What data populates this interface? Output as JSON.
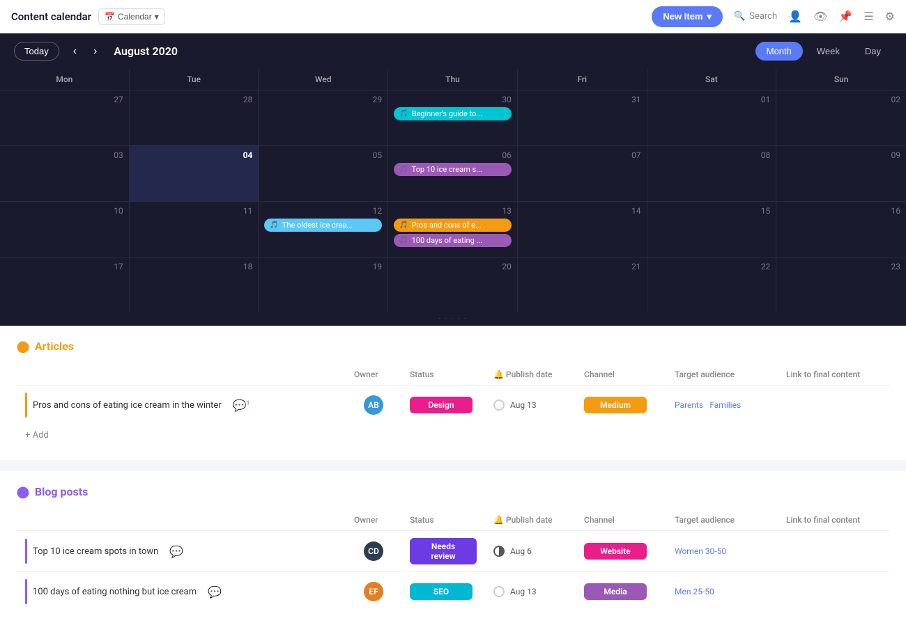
{
  "nav": {
    "title": "Content calendar",
    "calendar_btn": "Calendar",
    "new_item": "New Item",
    "search": "Search"
  },
  "calendar": {
    "month_label": "August 2020",
    "view_tabs": [
      "Month",
      "Week",
      "Day"
    ],
    "active_tab": "Month",
    "today_btn": "Today",
    "day_names": [
      "Mon",
      "Tue",
      "Wed",
      "Thu",
      "Fri",
      "Sat",
      "Sun"
    ],
    "weeks": [
      [
        {
          "date": "27",
          "events": []
        },
        {
          "date": "28",
          "events": []
        },
        {
          "date": "29",
          "events": []
        },
        {
          "date": "30",
          "events": [
            {
              "text": "Beginner's guide to...",
              "color": "cyan",
              "icon": "🎵"
            }
          ]
        },
        {
          "date": "31",
          "events": []
        },
        {
          "date": "01",
          "events": []
        },
        {
          "date": "02",
          "events": []
        }
      ],
      [
        {
          "date": "03",
          "events": []
        },
        {
          "date": "04",
          "events": [],
          "today": true
        },
        {
          "date": "05",
          "events": []
        },
        {
          "date": "06",
          "events": [
            {
              "text": "Top 10 ice cream s...",
              "color": "purple",
              "icon": "🎵"
            }
          ]
        },
        {
          "date": "07",
          "events": []
        },
        {
          "date": "08",
          "events": []
        },
        {
          "date": "09",
          "events": []
        }
      ],
      [
        {
          "date": "10",
          "events": []
        },
        {
          "date": "11",
          "events": []
        },
        {
          "date": "12",
          "events": [
            {
              "text": "The oldest ice crea...",
              "color": "blue-light",
              "icon": "🎵"
            }
          ]
        },
        {
          "date": "13",
          "events": [
            {
              "text": "Pros and cons of e...",
              "color": "orange",
              "icon": "🎵"
            },
            {
              "text": "100 days of eating ...",
              "color": "purple",
              "icon": "🎵"
            }
          ]
        },
        {
          "date": "14",
          "events": []
        },
        {
          "date": "15",
          "events": []
        },
        {
          "date": "16",
          "events": []
        }
      ],
      [
        {
          "date": "17",
          "events": []
        },
        {
          "date": "18",
          "events": []
        },
        {
          "date": "19",
          "events": []
        },
        {
          "date": "20",
          "events": []
        },
        {
          "date": "21",
          "events": []
        },
        {
          "date": "22",
          "events": []
        },
        {
          "date": "23",
          "events": []
        }
      ]
    ]
  },
  "articles": {
    "title": "Articles",
    "columns": [
      "Owner",
      "Status",
      "Publish date",
      "Channel",
      "Target audience",
      "Link to final content"
    ],
    "rows": [
      {
        "title": "Pros and cons of eating ice cream in the winter",
        "owner": "AB",
        "status": "Design",
        "status_class": "status-design",
        "publish_date": "Aug 13",
        "channel": "Medium",
        "channel_class": "channel-medium",
        "audience": [
          "Parents",
          "Families"
        ]
      }
    ],
    "add_label": "+ Add"
  },
  "blog_posts": {
    "title": "Blog posts",
    "columns": [
      "Owner",
      "Status",
      "Publish date",
      "Channel",
      "Target audience",
      "Link to final content"
    ],
    "rows": [
      {
        "title": "Top 10 ice cream spots in town",
        "owner": "CD",
        "owner_color": "avatar-dark",
        "status": "Needs review",
        "status_class": "status-needs-review",
        "publish_date": "Aug 6",
        "channel": "Website",
        "channel_class": "channel-website",
        "audience": [
          "Women 30-50"
        ],
        "radio": "half"
      },
      {
        "title": "100 days of eating nothing but ice cream",
        "owner": "EF",
        "owner_color": "avatar-orange",
        "status": "SEO",
        "status_class": "status-seo",
        "publish_date": "Aug 13",
        "channel": "Media",
        "channel_class": "channel-media",
        "audience": [
          "Men 25-50"
        ],
        "radio": "empty"
      }
    ]
  }
}
